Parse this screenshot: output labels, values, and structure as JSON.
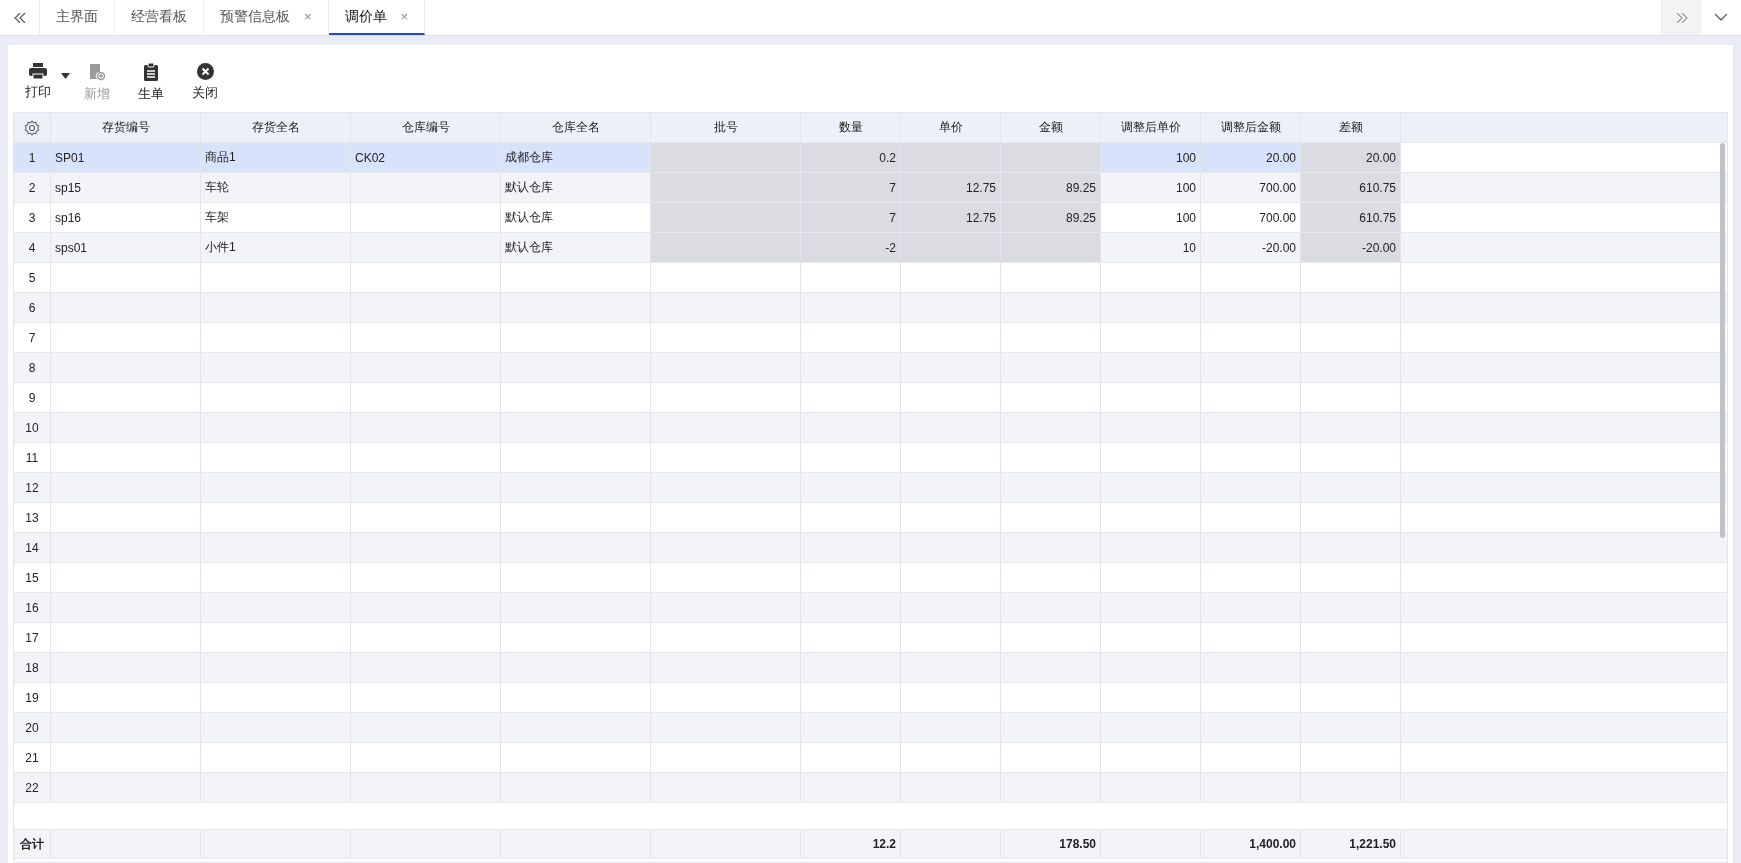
{
  "tabs": [
    {
      "label": "主界面",
      "selected": false,
      "closable": false
    },
    {
      "label": "经营看板",
      "selected": false,
      "closable": false
    },
    {
      "label": "预警信息板",
      "selected": false,
      "closable": true,
      "close": "×"
    },
    {
      "label": "调价单",
      "selected": true,
      "closable": true,
      "close": "×"
    }
  ],
  "toolbar": [
    {
      "kind": "print",
      "label": "打印",
      "disabled": false
    },
    {
      "kind": "menu",
      "disabled": false
    },
    {
      "kind": "new",
      "label": "新增",
      "disabled": true
    },
    {
      "kind": "generate",
      "label": "生单",
      "disabled": false
    },
    {
      "kind": "close",
      "label": "关闭",
      "disabled": false
    }
  ],
  "table": {
    "columns": [
      {
        "label": "存货编号",
        "kind": "text",
        "readonly": false
      },
      {
        "label": "存货全名",
        "kind": "text",
        "readonly": false
      },
      {
        "label": "仓库编号",
        "kind": "text",
        "readonly": false
      },
      {
        "label": "仓库全名",
        "kind": "text",
        "readonly": false
      },
      {
        "label": "批号",
        "kind": "text",
        "readonly": true
      },
      {
        "label": "数量",
        "kind": "number",
        "readonly": true
      },
      {
        "label": "单价",
        "kind": "number",
        "readonly": true
      },
      {
        "label": "金额",
        "kind": "number",
        "readonly": true
      },
      {
        "label": "调整后单价",
        "kind": "number",
        "readonly": false
      },
      {
        "label": "调整后金额",
        "kind": "number",
        "readonly": false
      },
      {
        "label": "差额",
        "kind": "number",
        "readonly": true
      }
    ],
    "rows": [
      {
        "number": "1",
        "selected": true,
        "cells": [
          "SP01",
          "商品1",
          "CK02",
          "成都仓库",
          null,
          "0.2",
          null,
          null,
          "100",
          "20.00",
          "20.00"
        ]
      },
      {
        "number": "2",
        "selected": false,
        "cells": [
          "sp15",
          "车轮",
          null,
          "默认仓库",
          null,
          "7",
          "12.75",
          "89.25",
          "100",
          "700.00",
          "610.75"
        ]
      },
      {
        "number": "3",
        "selected": false,
        "cells": [
          "sp16",
          "车架",
          null,
          "默认仓库",
          null,
          "7",
          "12.75",
          "89.25",
          "100",
          "700.00",
          "610.75"
        ]
      },
      {
        "number": "4",
        "selected": false,
        "cells": [
          "sps01",
          "小件1",
          null,
          "默认仓库",
          null,
          "-2",
          null,
          null,
          "10",
          "-20.00",
          "-20.00"
        ]
      },
      {
        "number": "5",
        "selected": false
      },
      {
        "number": "6",
        "selected": false
      },
      {
        "number": "7",
        "selected": false
      },
      {
        "number": "8",
        "selected": false
      },
      {
        "number": "9",
        "selected": false
      },
      {
        "number": "10",
        "selected": false
      },
      {
        "number": "11",
        "selected": false
      },
      {
        "number": "12",
        "selected": false
      },
      {
        "number": "13",
        "selected": false
      },
      {
        "number": "14",
        "selected": false
      },
      {
        "number": "15",
        "selected": false
      },
      {
        "number": "16",
        "selected": false
      },
      {
        "number": "17",
        "selected": false
      },
      {
        "number": "18",
        "selected": false
      },
      {
        "number": "19",
        "selected": false
      },
      {
        "number": "20",
        "selected": false
      },
      {
        "number": "21",
        "selected": false
      },
      {
        "number": "22",
        "selected": false
      }
    ],
    "footer": {
      "label": "合计",
      "cells": [
        null,
        null,
        null,
        null,
        null,
        "12.2",
        null,
        "178.50",
        null,
        "1,400.00",
        "1,221.50"
      ]
    }
  }
}
